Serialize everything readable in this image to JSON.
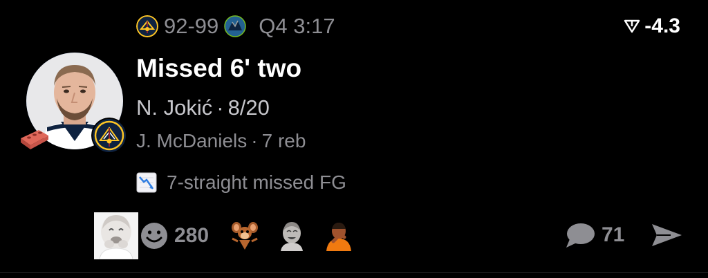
{
  "game": {
    "score": "92-99",
    "clock": "Q4 3:17",
    "home_team_icon": "nuggets-logo-icon",
    "away_team_icon": "timberwolves-logo-icon"
  },
  "odds": {
    "icon": "spread-triangle-icon",
    "spread": "-4.3"
  },
  "play": {
    "headline": "Missed 6' two",
    "player_name": "N. Jokić",
    "player_stat": "8/20",
    "assist_name": "J. McDaniels",
    "assist_stat": "7 reb",
    "separator": "·",
    "streak_icon": "chart-decreasing-icon",
    "streak_text": "7-straight missed FG"
  },
  "reactions": {
    "count": "280",
    "stickers": [
      "baby-laugh-sticker",
      "jerry-mouse-sticker",
      "baby-grin-sticker",
      "drake-sticker"
    ]
  },
  "comments": {
    "count": "71"
  },
  "colors": {
    "background": "#000000",
    "primary_text": "#ffffff",
    "secondary_text": "#8e8e93",
    "nuggets_navy": "#0e2240",
    "nuggets_gold": "#fec524",
    "wolves_blue": "#236192"
  }
}
